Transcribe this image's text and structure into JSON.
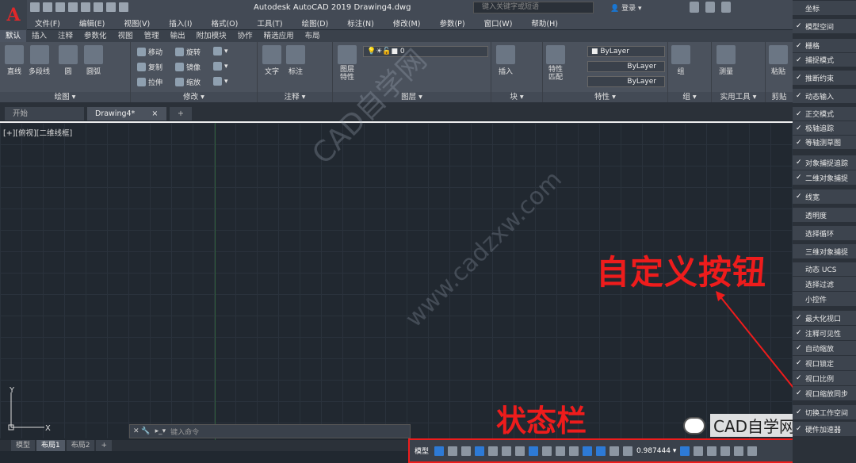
{
  "window": {
    "app_logo": "A",
    "title": "Autodesk AutoCAD 2019    Drawing4.dwg",
    "search_placeholder": "键入关键字或短语",
    "login": "登录"
  },
  "menubar": [
    "文件(F)",
    "编辑(E)",
    "视图(V)",
    "插入(I)",
    "格式(O)",
    "工具(T)",
    "绘图(D)",
    "标注(N)",
    "修改(M)",
    "参数(P)",
    "窗口(W)",
    "帮助(H)"
  ],
  "ribbon_tabs": [
    "默认",
    "插入",
    "注释",
    "参数化",
    "视图",
    "管理",
    "输出",
    "附加模块",
    "协作",
    "精选应用",
    "布局"
  ],
  "ribbon_tabs_active": "默认",
  "ribbon": {
    "draw": {
      "label": "绘图 ▾",
      "line": "直线",
      "polyline": "多段线",
      "circle": "圆",
      "arc": "圆弧"
    },
    "modify": {
      "label": "修改 ▾",
      "move": "移动",
      "rotate": "旋转",
      "copy": "复制",
      "mirror": "镜像",
      "stretch": "拉伸",
      "scale": "缩放"
    },
    "annotation": {
      "label": "注释 ▾",
      "text": "文字",
      "dimension": "标注"
    },
    "layers": {
      "label": "图层 ▾",
      "props": "图层\n特性",
      "current_layer": "0"
    },
    "block": {
      "label": "块 ▾",
      "insert": "插入"
    },
    "properties": {
      "label": "特性 ▾",
      "match": "特性\n匹配",
      "color": "ByLayer",
      "linetype": "ByLayer",
      "lineweight": "ByLayer"
    },
    "groups": {
      "label": "组 ▾",
      "group": "组"
    },
    "utilities": {
      "label": "实用工具 ▾",
      "measure": "测量"
    },
    "clipboard": {
      "label": "剪贴",
      "paste": "粘贴"
    }
  },
  "doc_tabs": [
    "开始",
    "Drawing4*"
  ],
  "doc_tabs_active": "Drawing4*",
  "viewport_label": "[+][俯视][二维线框]",
  "ucs": {
    "x": "X",
    "y": "Y"
  },
  "watermark": {
    "line1": "CAD自学网",
    "line2": "www.cadzxw.com"
  },
  "annotations": {
    "custom_button": "自定义按钮",
    "status_bar": "状态栏"
  },
  "command_placeholder": "键入命令",
  "layout_tabs": [
    "模型",
    "布局1",
    "布局2"
  ],
  "layout_tabs_active": "布局1",
  "statusbar": {
    "model": "模型",
    "zoom": "0.987444 ▾"
  },
  "wechat_label": "CAD自学网",
  "customize_menu": [
    {
      "label": "坐标",
      "checked": false
    },
    {
      "label": "模型空间",
      "checked": true
    },
    {
      "label": "栅格",
      "checked": true
    },
    {
      "label": "捕捉模式",
      "checked": true
    },
    {
      "label": "推断约束",
      "checked": true
    },
    {
      "label": "动态输入",
      "checked": true
    },
    {
      "label": "正交模式",
      "checked": true
    },
    {
      "label": "极轴追踪",
      "checked": true
    },
    {
      "label": "等轴测草图",
      "checked": true
    },
    {
      "label": "对象捕捉追踪",
      "checked": true
    },
    {
      "label": "二维对象捕捉",
      "checked": true
    },
    {
      "label": "线宽",
      "checked": true
    },
    {
      "label": "透明度",
      "checked": false
    },
    {
      "label": "选择循环",
      "checked": false
    },
    {
      "label": "三维对象捕捉",
      "checked": false
    },
    {
      "label": "动态 UCS",
      "checked": false
    },
    {
      "label": "选择过滤",
      "checked": false
    },
    {
      "label": "小控件",
      "checked": false
    },
    {
      "label": "最大化视口",
      "checked": true
    },
    {
      "label": "注释可见性",
      "checked": true
    },
    {
      "label": "自动缩放",
      "checked": true
    },
    {
      "label": "视口锁定",
      "checked": true
    },
    {
      "label": "视口比例",
      "checked": true
    },
    {
      "label": "视口缩放同步",
      "checked": true
    },
    {
      "label": "切换工作空间",
      "checked": true
    },
    {
      "label": "硬件加速器",
      "checked": true
    }
  ],
  "colors": {
    "annotation_red": "#ee1c1c",
    "viewport_bg": "#212830",
    "ribbon_bg": "#4b525d"
  }
}
